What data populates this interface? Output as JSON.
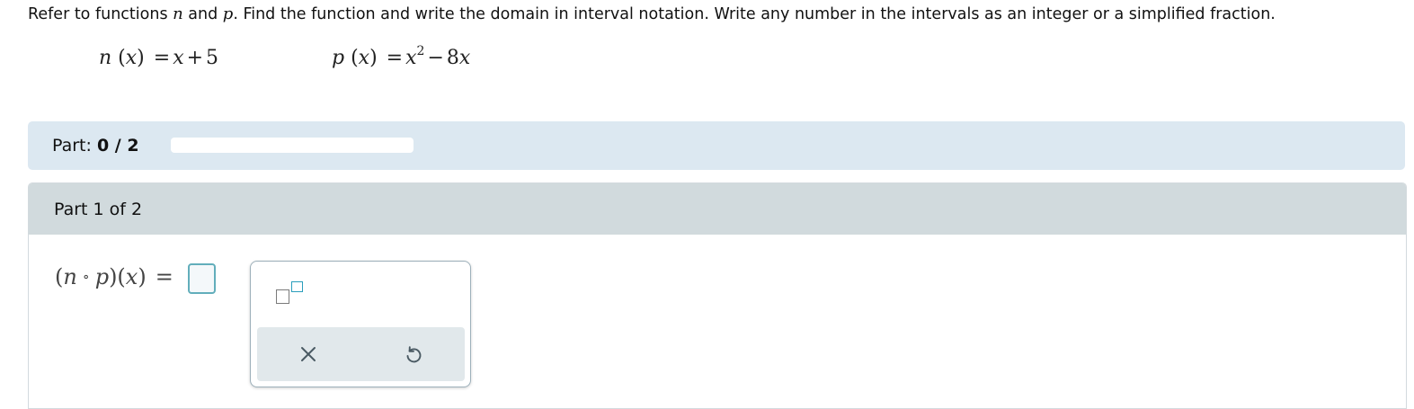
{
  "instruction": {
    "prefix": "Refer to functions ",
    "fn1": "n",
    "and": " and ",
    "fn2": "p",
    "suffix": ". Find the function and write the domain in interval notation. Write any number in the intervals as an integer or a simplified fraction."
  },
  "functions": {
    "n": {
      "name": "n",
      "var": "x",
      "eq": "=",
      "body_var": "x",
      "op": "+",
      "const": "5"
    },
    "p": {
      "name": "p",
      "var": "x",
      "eq": "=",
      "body_var": "x",
      "exp": "2",
      "op": "−",
      "coef": "8",
      "body_var2": "x"
    }
  },
  "part_progress": {
    "label": "Part: ",
    "value": "0 / 2",
    "fraction": 0
  },
  "part1": {
    "title": "Part 1 of 2"
  },
  "answer": {
    "outer": "n",
    "circ": "∘",
    "inner": "p",
    "var": "x",
    "eq": "="
  },
  "keypad": {
    "buttons": [
      "exponent-icon",
      "clear-icon",
      "undo-icon"
    ]
  },
  "colors": {
    "accent": "#2a9ebc",
    "part_bar_bg": "#dce8f1",
    "header_bg": "#d1dadd"
  }
}
